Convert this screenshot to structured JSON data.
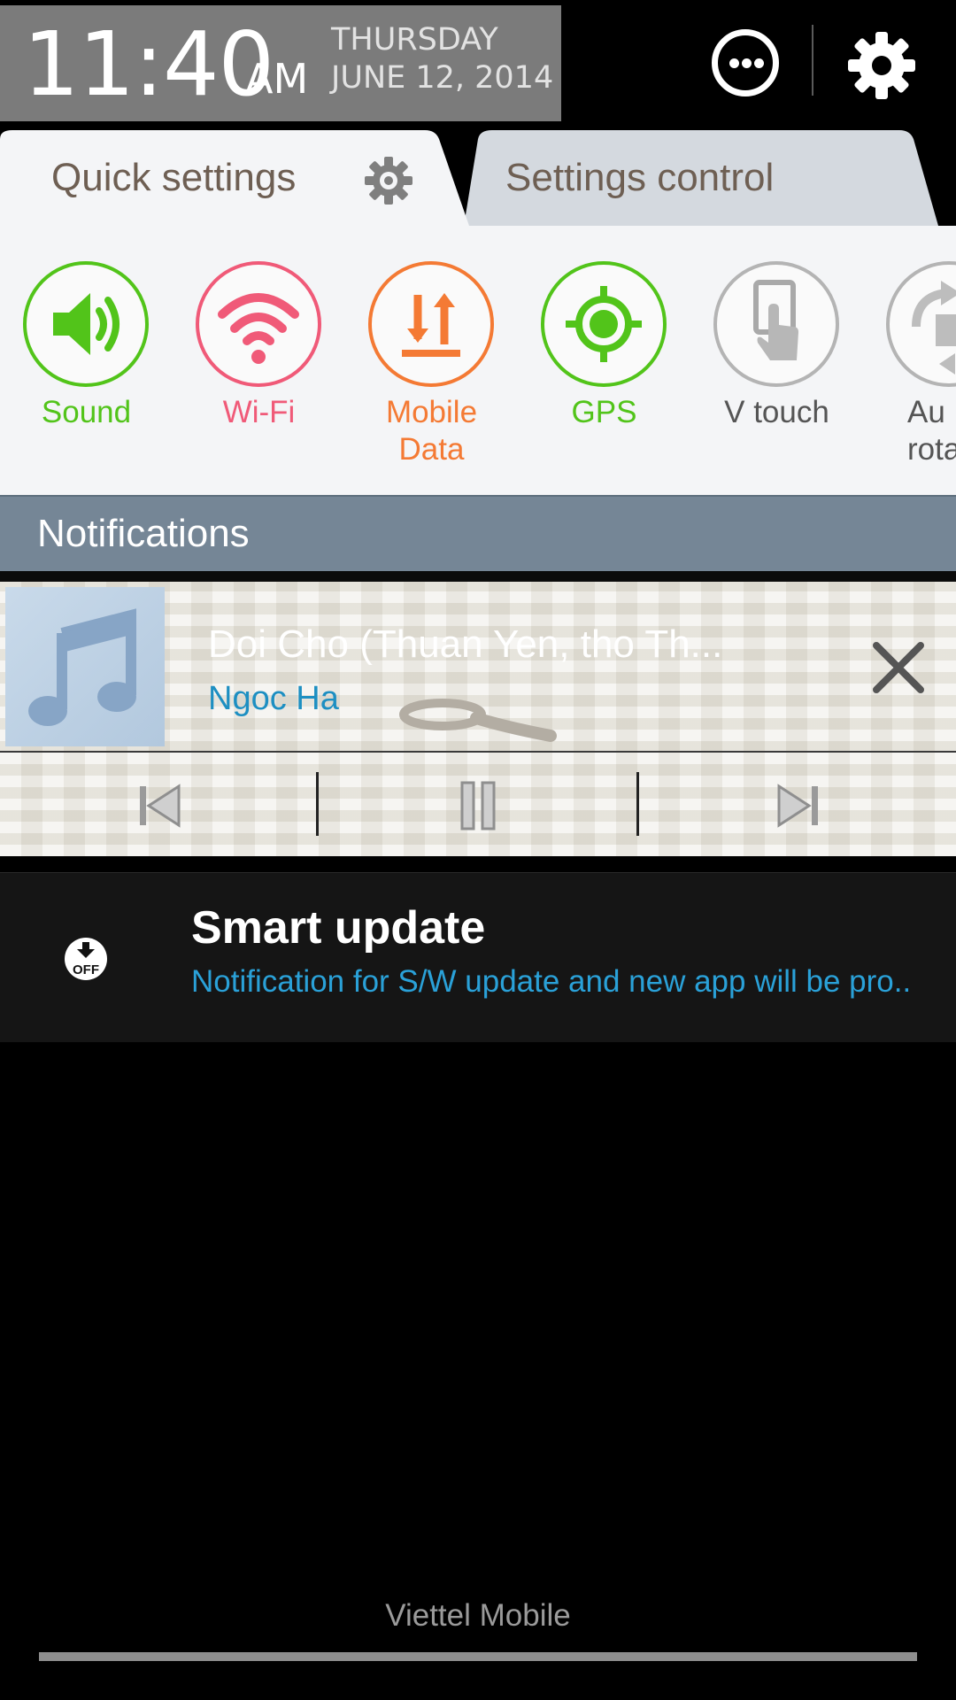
{
  "status": {
    "time": "11:40",
    "ampm": "AM",
    "day": "THURSDAY",
    "date": "JUNE 12, 2014"
  },
  "tabs": [
    {
      "label": "Quick settings",
      "active": true
    },
    {
      "label": "Settings control",
      "active": false
    }
  ],
  "quick_settings": [
    {
      "label": "Sound",
      "color": "#52c41a",
      "icon": "speaker-icon"
    },
    {
      "label": "Wi-Fi",
      "color": "#f05a78",
      "icon": "wifi-icon"
    },
    {
      "label_line1": "Mobile",
      "label_line2": "Data",
      "color": "#f47a34",
      "icon": "data-arrows-icon"
    },
    {
      "label": "GPS",
      "color": "#52c41a",
      "icon": "gps-target-icon"
    },
    {
      "label": "V touch",
      "color": "#a9a9a9",
      "icon": "touch-hand-icon"
    },
    {
      "label_line1": "Au",
      "label_line2": "rota",
      "color": "#a9a9a9",
      "icon": "auto-rotate-icon"
    }
  ],
  "notifications": {
    "header": "Notifications",
    "music": {
      "title": "Doi Cho (Thuan Yen, tho Th...",
      "artist": "Ngoc Ha"
    },
    "smart_update": {
      "title": "Smart update",
      "text": "Notification for S/W update and new app will be pro..",
      "icon_text": "OFF"
    }
  },
  "footer": {
    "carrier": "Viettel Mobile"
  },
  "colors": {
    "tab_text": "#6e5f53",
    "link_blue": "#1d8fc2",
    "notif_header": "#758696"
  }
}
